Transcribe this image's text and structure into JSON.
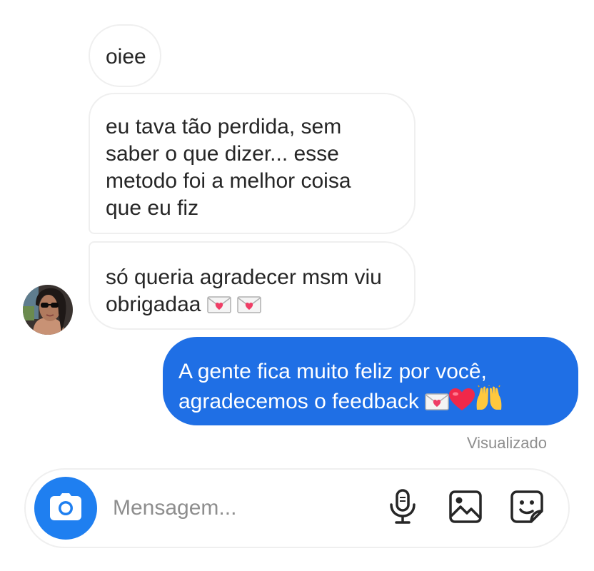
{
  "conversation": {
    "messages": [
      {
        "sender": "them",
        "text": "oiee"
      },
      {
        "sender": "them",
        "lines": [
          "eu tava tão perdida, sem",
          "saber o que dizer... esse",
          "metodo foi a melhor coisa",
          "que eu fiz"
        ]
      },
      {
        "sender": "them",
        "lines": [
          "só queria agradecer msm viu",
          "obrigadaa"
        ],
        "emoji": [
          "love-letter-emoji",
          "love-letter-emoji"
        ]
      },
      {
        "sender": "me",
        "lines": [
          "A gente fica muito feliz por você,",
          "agradecemos o feedback"
        ],
        "emoji": [
          "love-letter-emoji",
          "red-heart-emoji",
          "raising-hands-emoji"
        ]
      }
    ],
    "seen_status": "Visualizado"
  },
  "composer": {
    "placeholder": "Mensagem...",
    "icons": [
      "camera-icon",
      "microphone-icon",
      "gallery-icon",
      "sticker-icon"
    ]
  },
  "colors": {
    "outgoing_bubble": "#1f6fe5",
    "camera_button": "#1f7ff0",
    "incoming_border": "#efefef",
    "muted_text": "#8e8e8e"
  }
}
